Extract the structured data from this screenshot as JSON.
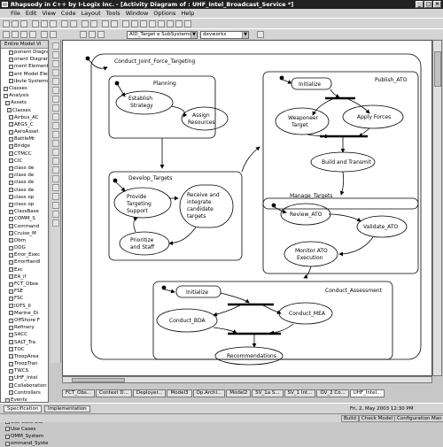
{
  "window": {
    "title": "Rhapsody in C++ by I-Logix Inc. - [Activity Diagram of : UHF_Intel_Broadcast_Service *]"
  },
  "menu": [
    "File",
    "Edit",
    "View",
    "Code",
    "Layout",
    "Tools",
    "Window",
    "Options",
    "Help"
  ],
  "toolbar": {
    "scope_combo": "AID_Target e SubSystems",
    "config_combo": "devworks"
  },
  "browser": {
    "header": "Entire Model Vi",
    "items": [
      "ponent Diagram",
      "onent Diagram",
      "ment Element",
      "ent Model Elemer",
      "ibute Systems",
      "Classes",
      "Analysis",
      "Assets",
      "Classes",
      "Airbus_AC",
      "AEGS_C",
      "AeroAsset",
      "BattleMr",
      "Bridge",
      "CTMCC",
      "CIC",
      "class de",
      "class de",
      "class de",
      "class de",
      "class op",
      "class op",
      "ClassBase",
      "COMM_S",
      "Command",
      "Cruise_M",
      "Dbm",
      "DDG",
      "Error_Exec",
      "ErrorHandl",
      "Exc",
      "EA_if",
      "FCT_Obse",
      "FSE",
      "FSC",
      "IOTS_II",
      "Marine_Di",
      "OffShore F",
      "Refinery",
      "SACC",
      "SALT_Tra",
      "TOC",
      "TroopArea",
      "TroopTran",
      "TWCS",
      "UHF_Intel",
      "Collaboration D",
      "Controllers",
      "Events",
      "Notes",
      "Packages",
      "Use Case Dia",
      "Use Cases",
      "OMM_System",
      "ommand_Syste"
    ]
  },
  "diagram": {
    "outer_title": "Conduct_Joint_Force_Targeting",
    "planning": {
      "title": "Planning",
      "states": [
        "Establish Strategy",
        "Assign Resources"
      ]
    },
    "develop": {
      "title": "Develop_Targets",
      "states": [
        "Provide Targeting Support",
        "Receive and integrate candidate targets",
        "Prioritize and Staff"
      ]
    },
    "publish": {
      "title": "Publish_ATO",
      "states": [
        "Initialize",
        "Weaponeer Target",
        "Apply Forces",
        "Build and Transmit"
      ]
    },
    "manage": {
      "title": "Manage_Targets",
      "states": [
        "Review_ATO",
        "Validate_ATO",
        "Monitor ATO Execution"
      ]
    },
    "assess": {
      "title": "Conduct_Assessment",
      "states": [
        "Initialize",
        "Conduct_BDA",
        "Conduct_MEA",
        "Recommendations"
      ]
    }
  },
  "doc_tabs": [
    "FCT_Obs...",
    "Context D...",
    "Deployer...",
    "Model3",
    "Op.Archi...",
    "Model2",
    "SV_1a S...",
    "SV_1 Int...",
    "OV_2 Co...",
    "UHF_Intel..."
  ],
  "bottom_tabs": [
    "Specification",
    "Implementation"
  ],
  "status": {
    "ready": "Build",
    "check": "Check Model",
    "config": "Configuration Man",
    "date": "Fri, 2, May 2003",
    "time": "12:30 PM"
  }
}
